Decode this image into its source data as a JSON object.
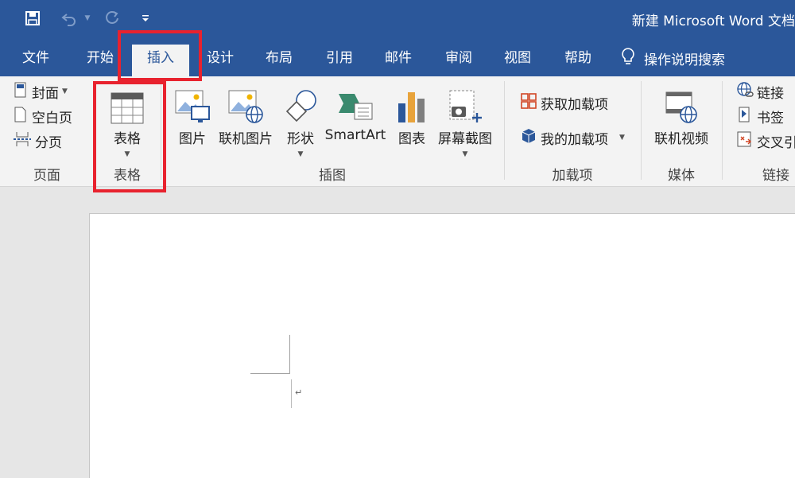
{
  "app": {
    "title": "新建 Microsoft Word 文档"
  },
  "qat": {
    "save_icon": "save-icon",
    "undo_icon": "undo-icon",
    "redo_icon": "redo-icon",
    "customize_icon": "customize-dropdown-icon"
  },
  "tabs": [
    "文件",
    "开始",
    "插入",
    "设计",
    "布局",
    "引用",
    "邮件",
    "审阅",
    "视图",
    "帮助"
  ],
  "tell_me": {
    "label": "操作说明搜索",
    "icon": "lightbulb-icon"
  },
  "ribbon": {
    "pages": {
      "label": "页面",
      "cover": "封面",
      "blank": "空白页",
      "break": "分页"
    },
    "tables": {
      "label": "表格",
      "table": "表格"
    },
    "illustrations": {
      "label": "插图",
      "picture": "图片",
      "online_picture": "联机图片",
      "shapes": "形状",
      "smartart": "SmartArt",
      "chart": "图表",
      "screenshot": "屏幕截图"
    },
    "addins": {
      "label": "加载项",
      "get": "获取加载项",
      "my": "我的加载项"
    },
    "media": {
      "label": "媒体",
      "online_video": "联机视频"
    },
    "links": {
      "label": "链接",
      "link": "链接",
      "bookmark": "书签",
      "crossref": "交叉引"
    }
  },
  "document": {
    "paragraph_mark": "↵"
  },
  "colors": {
    "brand": "#2b579a",
    "highlight": "#e8222e",
    "ribbon_bg": "#f3f3f3"
  }
}
